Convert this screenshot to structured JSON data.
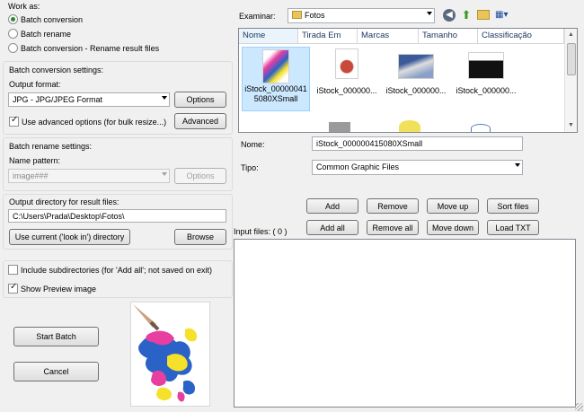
{
  "work_as": {
    "title": "Work as:",
    "options": [
      {
        "label": "Batch conversion",
        "selected": true
      },
      {
        "label": "Batch rename",
        "selected": false
      },
      {
        "label": "Batch conversion - Rename result files",
        "selected": false
      }
    ]
  },
  "conversion": {
    "title": "Batch conversion settings:",
    "format_label": "Output format:",
    "format_value": "JPG - JPG/JPEG Format",
    "options_button": "Options",
    "advanced_checkbox": "Use advanced options (for bulk resize...)",
    "advanced_checked": true,
    "advanced_button": "Advanced"
  },
  "rename": {
    "title": "Batch rename settings:",
    "pattern_label": "Name pattern:",
    "pattern_value": "image###",
    "options_button": "Options"
  },
  "output": {
    "title": "Output directory for result files:",
    "path": "C:\\Users\\Prada\\Desktop\\Fotos\\",
    "use_current_button": "Use current ('look in') directory",
    "browse_button": "Browse"
  },
  "flags": {
    "subdirs_label": "Include subdirectories (for 'Add all'; not saved on exit)",
    "subdirs_checked": false,
    "preview_label": "Show Preview image",
    "preview_checked": true
  },
  "actions": {
    "start_button": "Start Batch",
    "cancel_button": "Cancel"
  },
  "browser": {
    "look_in_label": "Examinar:",
    "look_in_value": "Fotos",
    "columns": [
      "Nome",
      "Tirada Em",
      "Marcas",
      "Tamanho",
      "Classificação"
    ],
    "files": [
      {
        "name": "iStock_000000415080XSmall",
        "selected": true
      },
      {
        "name": "iStock_000000...",
        "selected": false
      },
      {
        "name": "iStock_000000...",
        "selected": false
      },
      {
        "name": "iStock_000000...",
        "selected": false
      }
    ],
    "name_label": "Nome:",
    "name_value": "iStock_000000415080XSmall",
    "type_label": "Tipo:",
    "type_value": "Common Graphic Files"
  },
  "file_buttons": {
    "add": "Add",
    "remove": "Remove",
    "move_up": "Move up",
    "sort_files": "Sort files",
    "add_all": "Add all",
    "remove_all": "Remove all",
    "move_down": "Move down",
    "load_txt": "Load TXT"
  },
  "input_files_label": "Input files: ( 0 )",
  "colors": {
    "selection": "#cce8ff",
    "window": "#f0f0f0"
  }
}
